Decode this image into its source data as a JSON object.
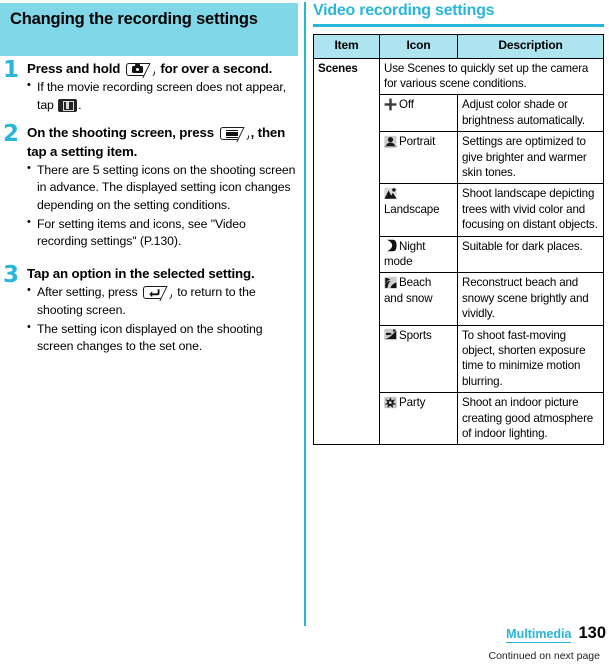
{
  "left": {
    "section_heading": "Changing the recording settings",
    "steps": [
      {
        "number": "1",
        "title_pre": "Press and hold",
        "title_icon": "camera-key-icon",
        "title_post": "for over a second.",
        "bullets": [
          {
            "pre": "If the movie recording screen does not appear, tap",
            "icon": "movie-mode-icon",
            "post": "."
          }
        ]
      },
      {
        "number": "2",
        "title_pre": "On the shooting screen, press",
        "title_icon": "menu-key-icon",
        "title_post": ", then tap a setting item.",
        "bullets": [
          {
            "pre": "There are 5 setting icons on the shooting screen in advance. The displayed setting icon changes depending on the setting conditions.",
            "icon": "",
            "post": ""
          },
          {
            "pre": "For setting items and icons, see \"Video recording settings\" (P.130).",
            "icon": "",
            "post": ""
          }
        ]
      },
      {
        "number": "3",
        "title_pre": "Tap an option in the selected setting.",
        "title_icon": "",
        "title_post": "",
        "bullets": [
          {
            "pre": "After setting, press",
            "icon": "back-key-icon",
            "post": "to return to the shooting screen."
          },
          {
            "pre": "The setting icon displayed on the shooting screen changes to the set one.",
            "icon": "",
            "post": ""
          }
        ]
      }
    ]
  },
  "right": {
    "title": "Video recording settings",
    "table": {
      "headers": [
        "Item",
        "Icon",
        "Description"
      ],
      "item_label": "Scenes",
      "intro": "Use Scenes to quickly set up the camera for various scene conditions.",
      "rows": [
        {
          "icon": "off-crosshair-icon",
          "icon_label": "Off",
          "description": "Adjust color shade or brightness automatically."
        },
        {
          "icon": "portrait-icon",
          "icon_label": "Portrait",
          "description": "Settings are optimized to give brighter and warmer skin tones."
        },
        {
          "icon": "landscape-icon",
          "icon_label": "Landscape",
          "description": "Shoot landscape depicting trees with vivid color and focusing on distant objects."
        },
        {
          "icon": "night-mode-icon",
          "icon_label": "Night mode",
          "description": "Suitable for dark places."
        },
        {
          "icon": "beach-snow-icon",
          "icon_label": "Beach and snow",
          "description": "Reconstruct beach and snowy scene brightly and vividly."
        },
        {
          "icon": "sports-icon",
          "icon_label": "Sports",
          "description": "To shoot fast-moving object, shorten exposure time to minimize motion blurring."
        },
        {
          "icon": "party-icon",
          "icon_label": "Party",
          "description": "Shoot an indoor picture creating good atmosphere of indoor lighting."
        }
      ]
    }
  },
  "footer": {
    "section": "Multimedia",
    "page_number": "130",
    "continued": "Continued on next page"
  },
  "colors": {
    "accent": "#29b6d8",
    "banner_bg": "#7fd7e8",
    "table_header_bg": "#aee4f0"
  }
}
